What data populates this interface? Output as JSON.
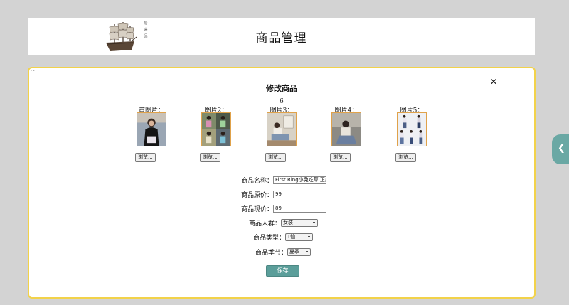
{
  "header": {
    "title": "商品管理",
    "logo_lines": [
      "船",
      "来",
      "品"
    ]
  },
  "dialog": {
    "title": "修改商品",
    "dots": "· ·",
    "stray_number": "6",
    "images": [
      {
        "label": "首图片：",
        "browse_label": "浏览...",
        "file_text": "..."
      },
      {
        "label": "图片2：",
        "browse_label": "浏览...",
        "file_text": "..."
      },
      {
        "label": "图片3：",
        "browse_label": "浏览...",
        "file_text": "..."
      },
      {
        "label": "图片4：",
        "browse_label": "浏览...",
        "file_text": "..."
      },
      {
        "label": "图片5：",
        "browse_label": "浏览...",
        "file_text": "..."
      }
    ],
    "form": {
      "name_label": "商品名称：",
      "name_value": "First Ring小兔吃草 正肩",
      "original_price_label": "商品原价：",
      "original_price_value": "99",
      "current_price_label": "商品现价：",
      "current_price_value": "89",
      "crowd_label": "商品人群：",
      "crowd_value": "女装",
      "type_label": "商品类型：",
      "type_value": "T恤",
      "season_label": "商品季节：",
      "season_value": "夏季"
    },
    "save_label": "保存"
  },
  "side_tab": {
    "glyph": "❮"
  },
  "colors": {
    "background": "#d3d3d3",
    "dialog_border": "#f2d24a",
    "accent": "#5b9e9a",
    "side_tab": "#6aa8a4"
  }
}
